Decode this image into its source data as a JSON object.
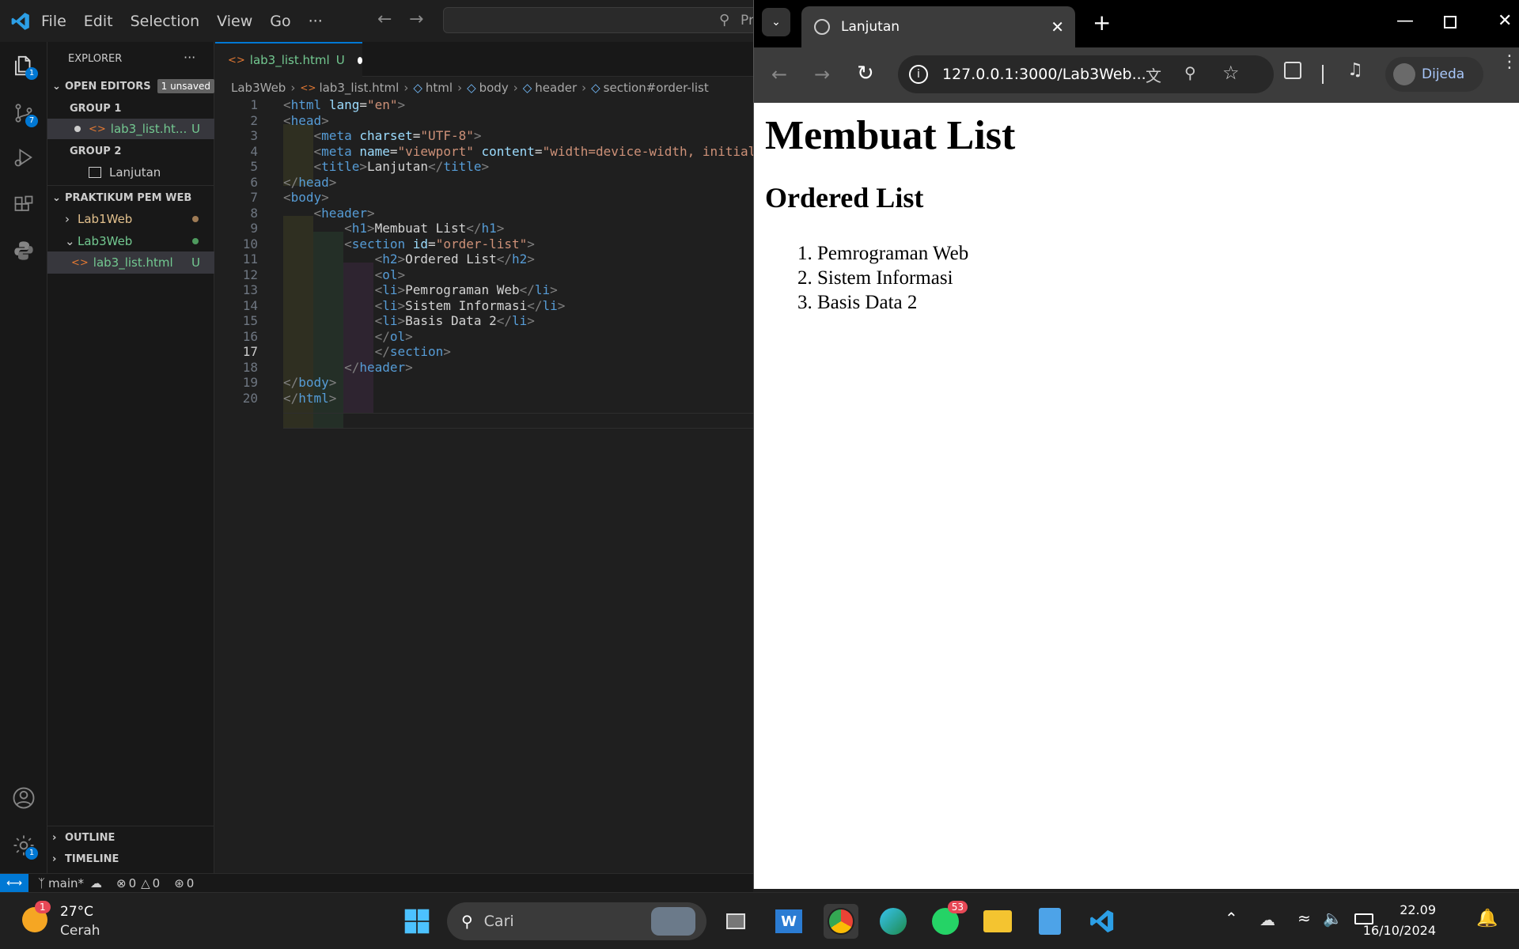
{
  "vscode": {
    "menu": [
      "File",
      "Edit",
      "Selection",
      "View",
      "Go",
      "···"
    ],
    "search_placeholder": "Pr",
    "activity_badges": {
      "explorer": "1",
      "scm": "7",
      "settings": "1"
    },
    "sidebar": {
      "title": "EXPLORER",
      "open_editors": "OPEN EDITORS",
      "unsaved_badge": "1 unsaved",
      "group1": "GROUP 1",
      "group1_file": "lab3_list.ht...",
      "group1_status": "U",
      "group2": "GROUP 2",
      "group2_file": "Lanjutan",
      "project": "PRAKTIKUM PEM WEB",
      "folder1": "Lab1Web",
      "folder2": "Lab3Web",
      "file": "lab3_list.html",
      "file_status": "U",
      "outline": "OUTLINE",
      "timeline": "TIMELINE"
    },
    "tab": {
      "label": "lab3_list.html",
      "status": "U"
    },
    "breadcrumb": [
      "Lab3Web",
      "lab3_list.html",
      "html",
      "body",
      "header",
      "section#order-list"
    ],
    "code_lines": [
      "<html lang=\"en\">",
      "<head>",
      "    <meta charset=\"UTF-8\">",
      "    <meta name=\"viewport\" content=\"width=device-width, initial",
      "    <title>Lanjutan</title>",
      "</head>",
      "<body>",
      "    <header>",
      "        <h1>Membuat List</h1>",
      "        <section id=\"order-list\">",
      "            <h2>Ordered List</h2>",
      "            <ol>",
      "            <li>Pemrograman Web</li>",
      "            <li>Sistem Informasi</li>",
      "            <li>Basis Data 2</li>",
      "            </ol>",
      "            </section>",
      "        </header>",
      "</body>",
      "</html>"
    ],
    "status": {
      "branch": "main*",
      "errors": "0",
      "warnings": "0",
      "ports": "0"
    }
  },
  "browser": {
    "tab_title": "Lanjutan",
    "url": "127.0.0.1:3000/Lab3Web...",
    "profile": "Dijeda",
    "page": {
      "h1": "Membuat List",
      "h2": "Ordered List",
      "items": [
        "Pemrograman Web",
        "Sistem Informasi",
        "Basis Data 2"
      ]
    }
  },
  "taskbar": {
    "weather_temp": "27°C",
    "weather_desc": "Cerah",
    "weather_badge": "1",
    "search_placeholder": "Cari",
    "whatsapp_badge": "53",
    "time": "22.09",
    "date": "16/10/2024"
  },
  "colors": {
    "accent": "#0078d4",
    "git_untracked": "#73c991",
    "modified": "#e2c08d"
  }
}
